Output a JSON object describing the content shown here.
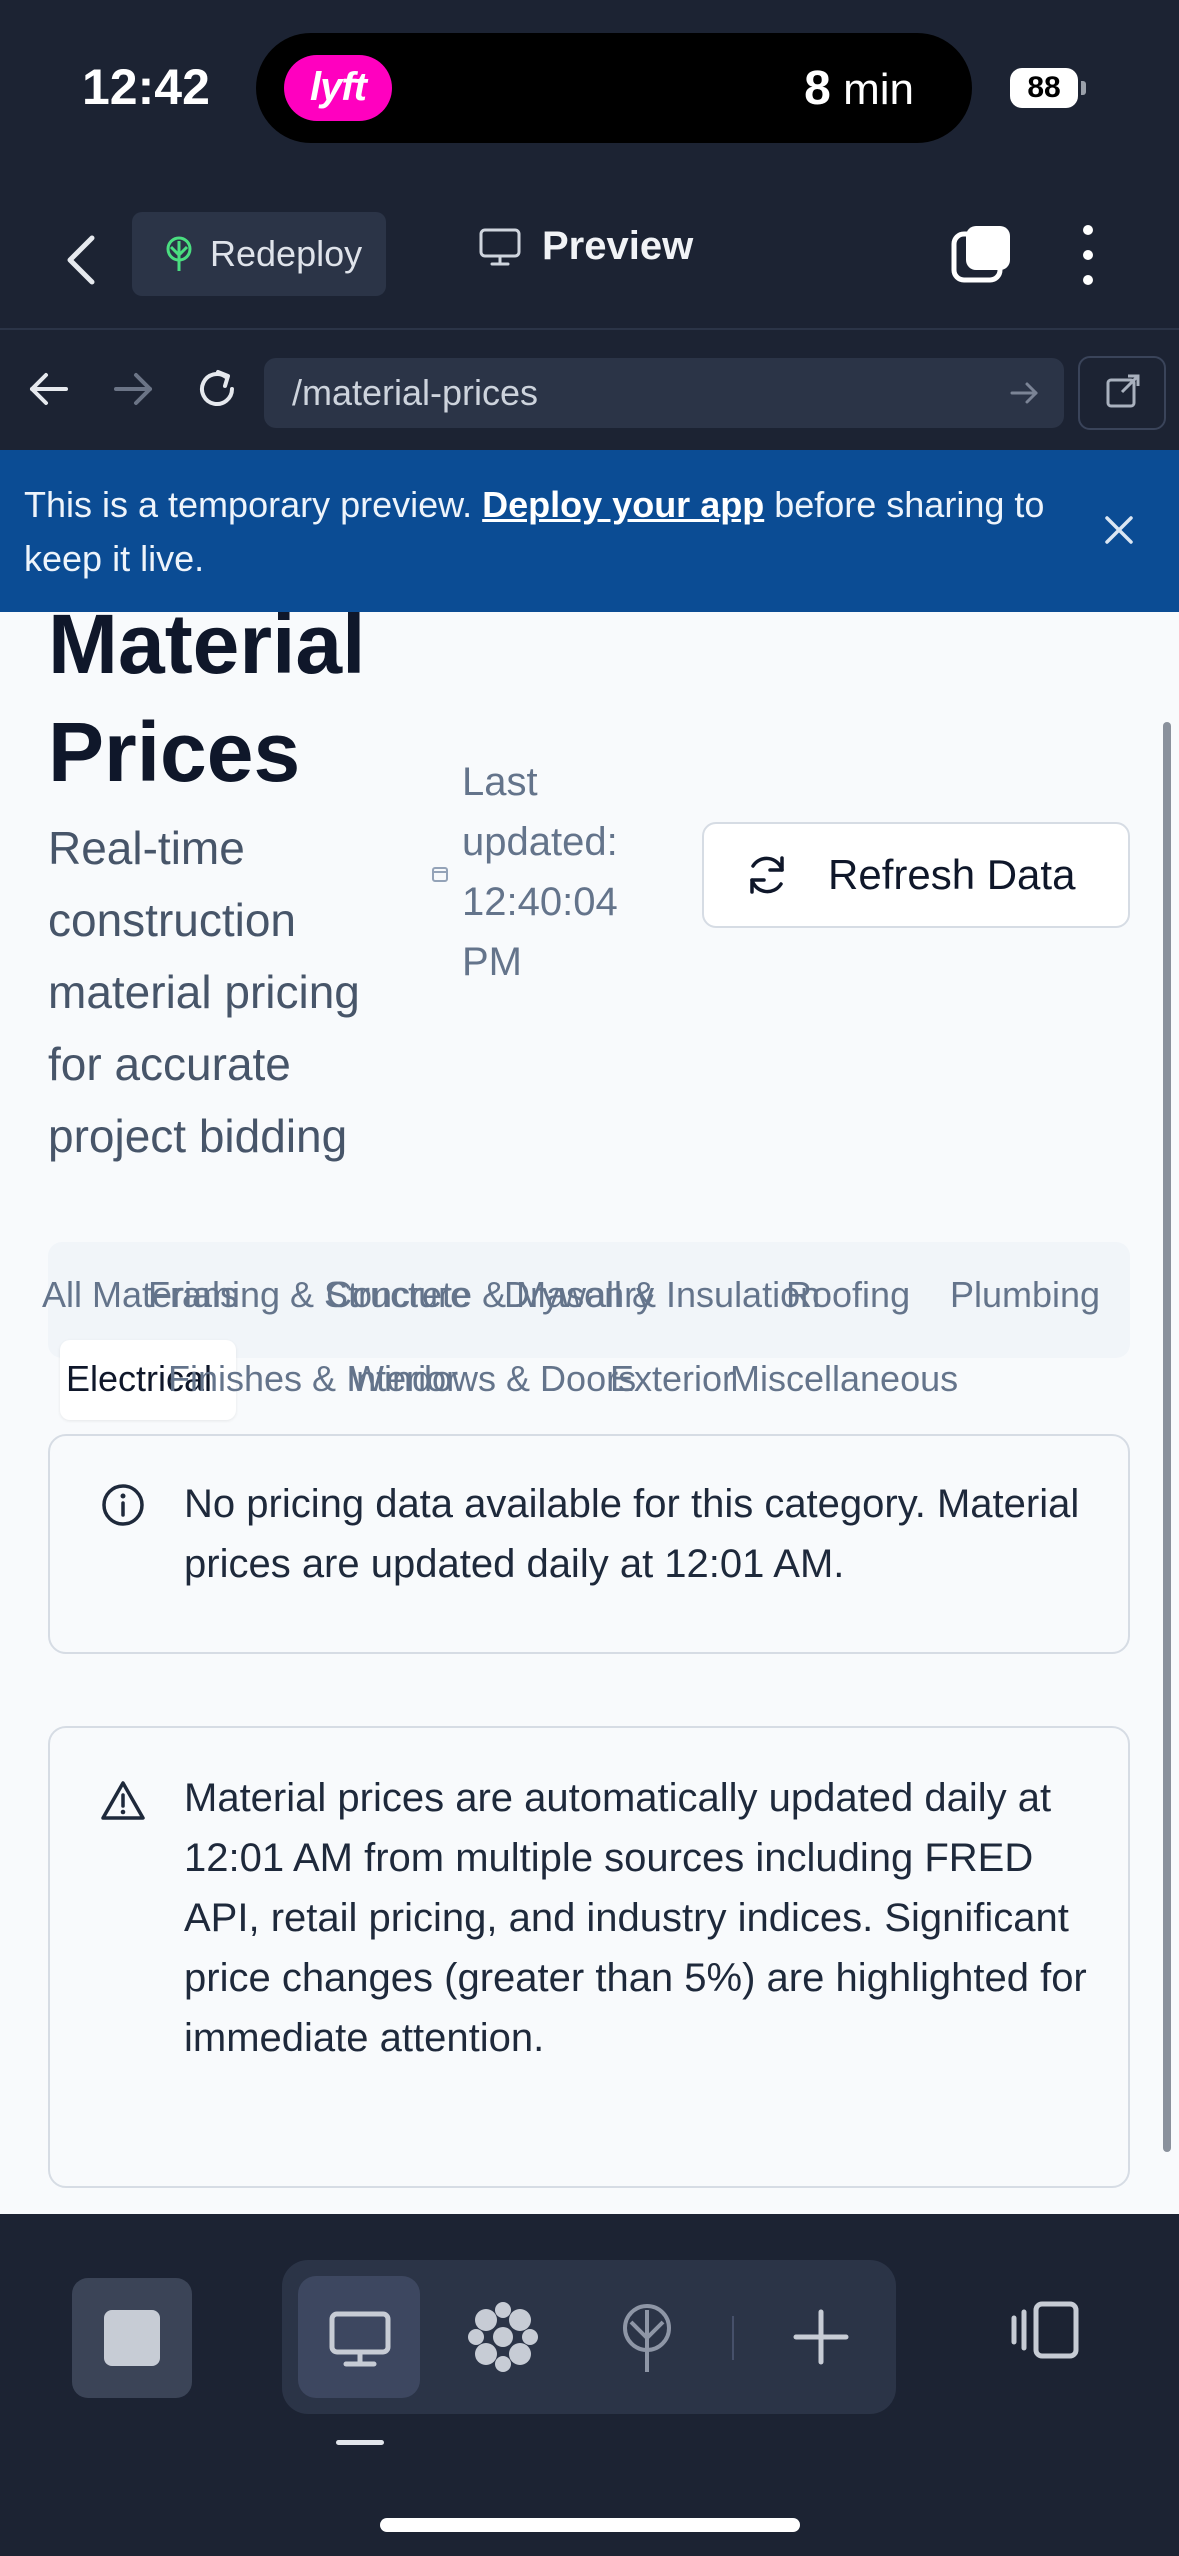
{
  "status_bar": {
    "time": "12:42",
    "live_activity_app": "lyft",
    "eta_value": "8",
    "eta_unit": " min",
    "battery": "88"
  },
  "app_header": {
    "redeploy_label": "Redeploy",
    "preview_label": "Preview"
  },
  "url_bar": {
    "path": "/material-prices"
  },
  "banner": {
    "text_before": "This is a temporary preview. ",
    "link_text": "Deploy your app",
    "text_after": " before sharing to keep it live."
  },
  "page": {
    "title": "Material Prices",
    "subtitle": "Real-time construction material pricing for accurate project bidding",
    "last_updated": "Last updated: 12:40:04 PM",
    "refresh_label": "Refresh Data"
  },
  "category_tabs": {
    "row1": [
      "All Materials",
      "Framing & Structure",
      "Concrete & Masonry",
      "Drywall & Insulation",
      "Roofing",
      "Plumbing"
    ],
    "row2": [
      "Electrical",
      "Finishes & Interior",
      "Windows & Doors",
      "Exterior",
      "Miscellaneous"
    ],
    "active": "Electrical"
  },
  "alerts": {
    "no_data": "No pricing data available for this category. Material prices are updated daily at 12:01 AM.",
    "update_notice": "Material prices are automatically updated daily at 12:01 AM from multiple sources including FRED API, retail pricing, and industry indices. Significant price changes (greater than 5%) are highlighted for immediate attention."
  },
  "colors": {
    "chrome_bg": "#1c2333",
    "banner_bg": "#0b4c94",
    "lyft_pink": "#ff00bf",
    "page_bg": "#f8fafc"
  },
  "icons": {
    "back": "chevron-left-icon",
    "redeploy": "deploy-tree-icon",
    "preview": "monitor-icon",
    "tabs": "tabs-icon",
    "more": "more-vertical-icon",
    "refresh": "refresh-icon",
    "info": "info-icon",
    "warning": "warning-triangle-icon"
  }
}
